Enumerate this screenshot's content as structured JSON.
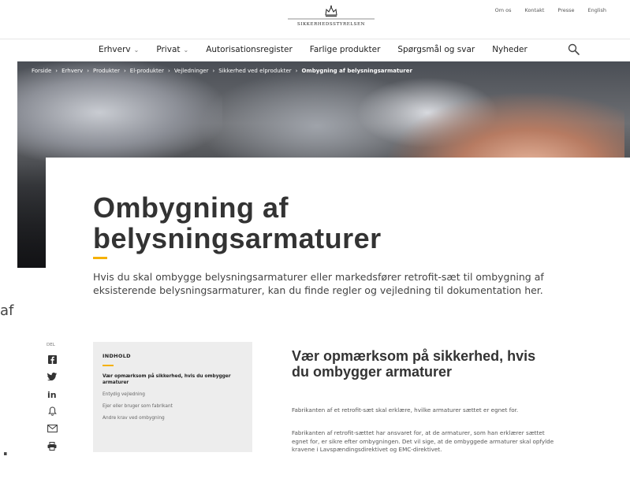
{
  "header": {
    "logo_text": "SIKKERHEDSSTYRELSEN",
    "utility_links": [
      "Om os",
      "Kontakt",
      "Presse",
      "English"
    ]
  },
  "nav": {
    "items": [
      {
        "label": "Erhverv",
        "dropdown": true
      },
      {
        "label": "Privat",
        "dropdown": true
      },
      {
        "label": "Autorisationsregister",
        "dropdown": false
      },
      {
        "label": "Farlige produkter",
        "dropdown": false
      },
      {
        "label": "Spørgsmål og svar",
        "dropdown": false
      },
      {
        "label": "Nyheder",
        "dropdown": false
      }
    ],
    "search_icon": "search-icon"
  },
  "breadcrumb": [
    "Forside",
    "Erhverv",
    "Produkter",
    "El-produkter",
    "Vejledninger",
    "Sikkerhed ved elprodukter",
    "Ombygning af belysningsarmaturer"
  ],
  "page": {
    "title": "Ombygning af belysningsarmaturer",
    "lead": "Hvis du skal ombygge belysningsarmaturer eller markedsfører retrofit-sæt til ombygning af eksisterende belysningsarmaturer, kan du finde regler og vejledning til dokumentation her.",
    "accent_color": "#f5b100"
  },
  "share": {
    "label": "DEL",
    "icons": [
      "facebook-icon",
      "twitter-icon",
      "linkedin-icon",
      "bell-icon",
      "mail-icon",
      "print-icon"
    ]
  },
  "toc": {
    "heading": "INDHOLD",
    "items": [
      {
        "label": "Vær opmærksom på sikkerhed, hvis du ombygger armaturer",
        "active": true
      },
      {
        "label": "Entydig vejledning",
        "active": false
      },
      {
        "label": "Ejer eller bruger som fabrikant",
        "active": false
      },
      {
        "label": "Andre krav ved ombygning",
        "active": false
      }
    ]
  },
  "section": {
    "title": "Vær opmærksom på sikkerhed, hvis du ombygger armaturer",
    "paragraphs": [
      "Fabrikanten af et retrofit-sæt skal erklære, hvilke armaturer sættet er egnet for.",
      "Fabrikanten af retrofit-sættet har ansvaret for, at de armaturer, som han erklærer sættet egnet for, er sikre efter ombygningen. Det vil sige, at de ombyggede armaturer skal opfylde kravene i Lavspændingsdirektivet og EMC-direktivet."
    ]
  },
  "edge_fragments": {
    "left_af": "af",
    "left_dot": "."
  }
}
